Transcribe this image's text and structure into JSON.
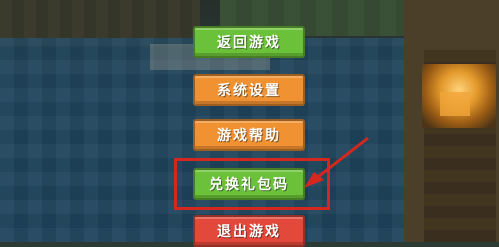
{
  "menu": {
    "items": [
      {
        "label": "返回游戏",
        "color": "#6cc13a"
      },
      {
        "label": "系统设置",
        "color": "#f09232"
      },
      {
        "label": "游戏帮助",
        "color": "#f09232"
      },
      {
        "label": "兑换礼包码",
        "color": "#6cc13a"
      },
      {
        "label": "退出游戏",
        "color": "#e2493b"
      }
    ]
  },
  "annotation": {
    "highlight_color": "#d4281e",
    "arrow_icon": "arrow-icon"
  }
}
